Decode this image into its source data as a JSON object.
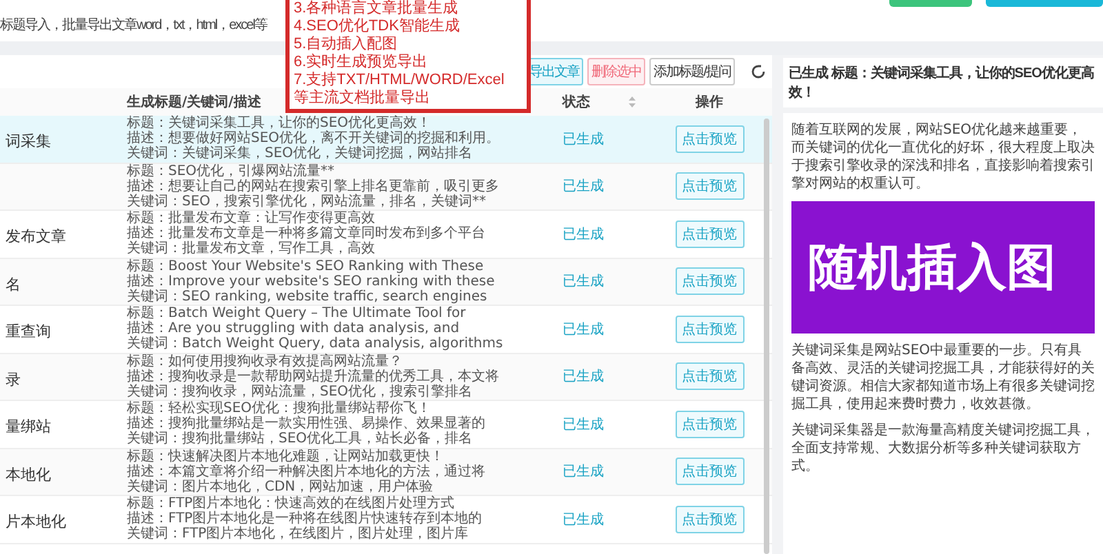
{
  "intro": "标题导入，批量导出文章word，txt，html，excel等",
  "features": [
    "3.各种语言文章批量生成",
    "4.SEO优化TDK智能生成",
    "5.自动插入配图",
    "6.实时生成预览导出",
    "7.支持TXT/HTML/WORD/Excel",
    "等主流文档批量导出"
  ],
  "toolbar": [
    {
      "label": "导出文章",
      "kind": "primary"
    },
    {
      "label": "删除选中",
      "kind": "danger"
    },
    {
      "label": "添加标题/提问",
      "kind": "plain"
    }
  ],
  "columns": [
    "生成标题/关键词/描述",
    "状态",
    "操作"
  ],
  "rows": [
    {
      "name": "词采集",
      "selected": true,
      "lines": [
        "标题：关键词采集工具，让你的SEO优化更高效！",
        "描述：想要做好网站SEO优化，离不开关键词的挖掘和利用。",
        "关键词：关键词采集，SEO优化，关键词挖掘，网站排名"
      ],
      "status": "已生成",
      "action": "点击预览"
    },
    {
      "selected": false,
      "lines": [
        "标题：SEO优化，引爆网站流量**",
        "描述：想要让自己的网站在搜索引擎上排名更靠前，吸引更多",
        "关键词：SEO，搜索引擎优化，网站流量，排名，关键词**"
      ],
      "status": "已生成",
      "action": "点击预览"
    },
    {
      "name": "发布文章",
      "selected": false,
      "lines": [
        "标题：批量发布文章：让写作变得更高效",
        "描述：批量发布文章是一种将多篇文章同时发布到多个平台",
        "关键词：批量发布文章，写作工具，高效"
      ],
      "status": "已生成",
      "action": "点击预览"
    },
    {
      "name": "名",
      "selected": false,
      "lines": [
        "标题：Boost Your Website's SEO Ranking with These",
        "描述：Improve your website's SEO ranking with these",
        "关键词：SEO ranking, website traffic, search engines"
      ],
      "status": "已生成",
      "action": "点击预览"
    },
    {
      "name": "重查询",
      "selected": false,
      "lines": [
        "标题：Batch Weight Query – The Ultimate Tool for",
        "描述：Are you struggling with data analysis, and",
        "关键词：Batch Weight Query, data analysis, algorithms"
      ],
      "status": "已生成",
      "action": "点击预览"
    },
    {
      "name": "录",
      "selected": false,
      "lines": [
        "标题：如何使用搜狗收录有效提高网站流量？",
        "描述：搜狗收录是一款帮助网站提升流量的优秀工具，本文将",
        "关键词：搜狗收录，网站流量，SEO优化，搜索引擎排名"
      ],
      "status": "已生成",
      "action": "点击预览"
    },
    {
      "name": "量绑站",
      "selected": false,
      "lines": [
        "标题：轻松实现SEO优化：搜狗批量绑站帮你飞！",
        "描述：搜狗批量绑站是一款实用性强、易操作、效果显著的",
        "关键词：搜狗批量绑站，SEO优化工具，站长必备，排名"
      ],
      "status": "已生成",
      "action": "点击预览"
    },
    {
      "name": "本地化",
      "selected": false,
      "lines": [
        "标题：快速解决图片本地化难题，让网站加载更快！",
        "描述：本篇文章将介绍一种解决图片本地化的方法，通过将",
        "关键词：图片本地化，CDN，网站加速，用户体验"
      ],
      "status": "已生成",
      "action": "点击预览"
    },
    {
      "name": "片本地化",
      "selected": false,
      "lines": [
        "标题：FTP图片本地化：快速高效的在线图片处理方式",
        "描述：FTP图片本地化是一种将在线图片快速转存到本地的",
        "关键词：FTP图片本地化，在线图片，图片处理，图片库"
      ],
      "status": "已生成",
      "action": "点击预览"
    }
  ],
  "preview": {
    "status": "已生成",
    "title": "标题：关键词采集工具，让你的SEO优化更高效！",
    "paragraphs": [
      "随着互联网的发展，网站SEO优化越来越重要，而关键词的优化一直优化的好坏，很大程度上取决于搜索引擎收录的深浅和排名，直接影响着搜索引擎对网站的权重认可。",
      "关键词采集是网站SEO中最重要的一步。只有具备高效、灵活的关键词挖掘工具，才能获得好的关键词资源。相信大家都知道市场上有很多关键词挖掘工具，使用起来费时费力，收效甚微。",
      "关键词采集器是一款海量高精度关键词挖掘工具，全面支持常规、大数据分析等多种关键词获取方式。"
    ],
    "banner": "随机插入图"
  }
}
